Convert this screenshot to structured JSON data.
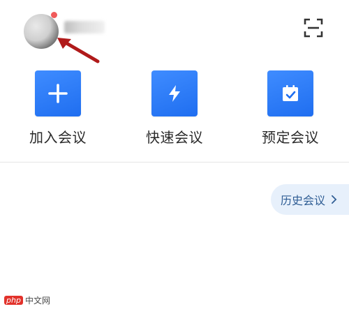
{
  "header": {
    "avatar_icon": "user-avatar",
    "notification_color": "#f05a5a",
    "scan_icon": "scan-icon"
  },
  "actions": [
    {
      "label": "加入会议",
      "icon": "plus-icon"
    },
    {
      "label": "快速会议",
      "icon": "lightning-icon"
    },
    {
      "label": "预定会议",
      "icon": "calendar-check-icon"
    }
  ],
  "history": {
    "label": "历史会议",
    "icon": "chevron-right-icon"
  },
  "watermark": {
    "badge": "php",
    "text": "中文网"
  },
  "colors": {
    "accent": "#1f6ef0",
    "pill_bg": "#e7f0fb",
    "pill_text": "#2f5d94",
    "annotation": "#b01a1a"
  }
}
